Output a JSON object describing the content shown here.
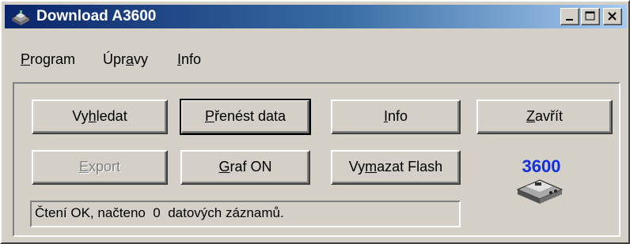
{
  "window": {
    "title": "Download A3600",
    "icon": "printer-icon",
    "title_gradient": [
      "#0a246a",
      "#a6caf0"
    ]
  },
  "menu": {
    "items": [
      {
        "label": "Program",
        "mnemonic": "P"
      },
      {
        "label": "Úpravy",
        "mnemonic": "a"
      },
      {
        "label": "Info",
        "mnemonic": "I"
      }
    ]
  },
  "buttons": {
    "vyhledat": "Vyhledat",
    "prenest": "Přenést data",
    "info": "Info",
    "zavrit": "Zavřít",
    "export": "Export",
    "graf": "Graf ON",
    "vymazat": "Vymazat Flash"
  },
  "status": {
    "text": "Čtení OK, načteno  0  datových záznamů."
  },
  "logo": {
    "text": "3600",
    "color": "#1030e0"
  }
}
